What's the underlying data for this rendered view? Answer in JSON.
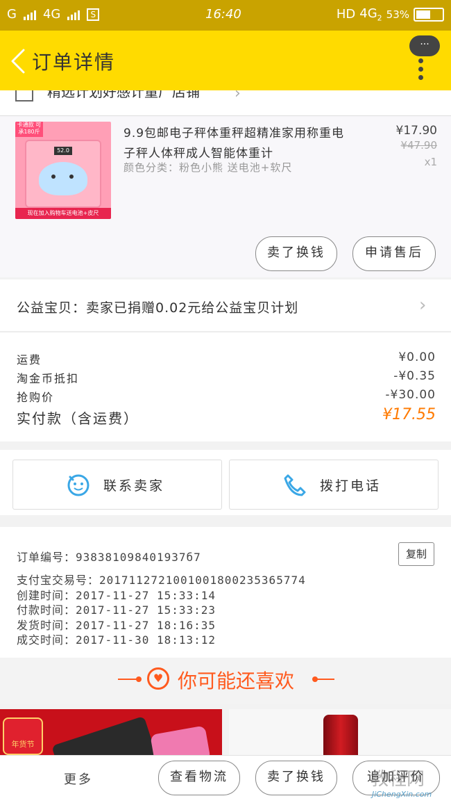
{
  "status_bar": {
    "carrier_left": "G",
    "network": "4G",
    "sim_icon": "S",
    "time": "16:40",
    "hd_label": "HD",
    "network_right": "4G",
    "network_sub": "2",
    "battery": "53%"
  },
  "header": {
    "title": "订单详情",
    "menu_dots": "···"
  },
  "shop": {
    "name": "精选计划好感计量厂店铺"
  },
  "product": {
    "thumb_tag": "卡通款 可承180斤",
    "thumb_caption": "现在加入购物车送电池+皮尺",
    "thumb_lcd": "52.0",
    "title": "9.9包邮电子秤体重秤超精准家用称重电子秤人体秤成人智能体重计",
    "sku": "颜色分类：粉色小熊   送电池+软尺",
    "price": "¥17.90",
    "original_price": "¥47.90",
    "quantity": "x1",
    "buttons": {
      "exchange": "卖了换钱",
      "after_sale": "申请售后"
    }
  },
  "donation": {
    "text": "公益宝贝：卖家已捐赠0.02元给公益宝贝计划"
  },
  "fees": {
    "shipping_label": "运费",
    "shipping_value": "¥0.00",
    "coin_label": "淘金币抵扣",
    "coin_value": "-¥0.35",
    "rush_label": "抢购价",
    "rush_value": "-¥30.00",
    "paid_label": "实付款（含运费）",
    "paid_value": "¥17.55"
  },
  "contact": {
    "seller_label": "联系卖家",
    "call_label": "拨打电话"
  },
  "order": {
    "order_no": "订单编号：938381098401937б7",
    "copy_label": "复制",
    "alipay_no": "支付宝交易号：2017112721001001800235365774",
    "created": "创建时间：2017-11-27 15:33:14",
    "paid": "付款时间：2017-11-27 15:33:23",
    "shipped": "发货时间：2017-11-27 18:16:35",
    "completed": "成交时间：2017-11-30 18:13:12"
  },
  "recommend": {
    "title": "你可能还喜欢",
    "badge_text": "年货节"
  },
  "bottom_bar": {
    "more": "更多",
    "logistics": "查看物流",
    "exchange": "卖了换钱",
    "review": "追加评价"
  },
  "watermark": {
    "text": "教程网",
    "url": "JiChengXin.com"
  },
  "colors": {
    "status_bar": "#c9a300",
    "header": "#ffdb00",
    "accent_orange": "#ff7a00",
    "recommend_red": "#ff5a1e",
    "icon_blue": "#3aa7e6"
  }
}
